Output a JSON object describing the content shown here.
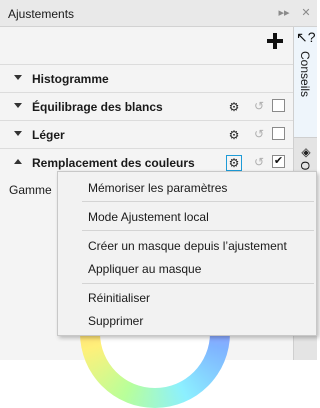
{
  "window": {
    "title": "Ajustements",
    "controls": [
      "▸▸",
      "✕"
    ]
  },
  "rows": [
    {
      "label": "Histogramme",
      "expanded": false,
      "has_controls": false
    },
    {
      "label": "Équilibrage des blancs",
      "expanded": false,
      "has_controls": true,
      "checked": false
    },
    {
      "label": "Léger",
      "expanded": false,
      "has_controls": true,
      "checked": false
    },
    {
      "label": "Remplacement des couleurs",
      "expanded": true,
      "has_controls": true,
      "checked": true
    }
  ],
  "content": {
    "gamme_label": "Gamme"
  },
  "sidebar": {
    "conseils_label": "Conseils",
    "objets_label": "Objets"
  },
  "context_menu": {
    "items": [
      "Mémoriser les paramètres",
      "Mode Ajustement local",
      "Créer un masque depuis l’ajustement",
      "Appliquer au masque",
      "Réinitialiser",
      "Supprimer"
    ]
  },
  "icons": {
    "add": "plus-icon",
    "settings": "gear-icon",
    "reset": "undo-icon",
    "tips": "question-cursor-icon",
    "objects": "layers-icon"
  },
  "colors": {
    "active_border": "#1e9bd7"
  }
}
